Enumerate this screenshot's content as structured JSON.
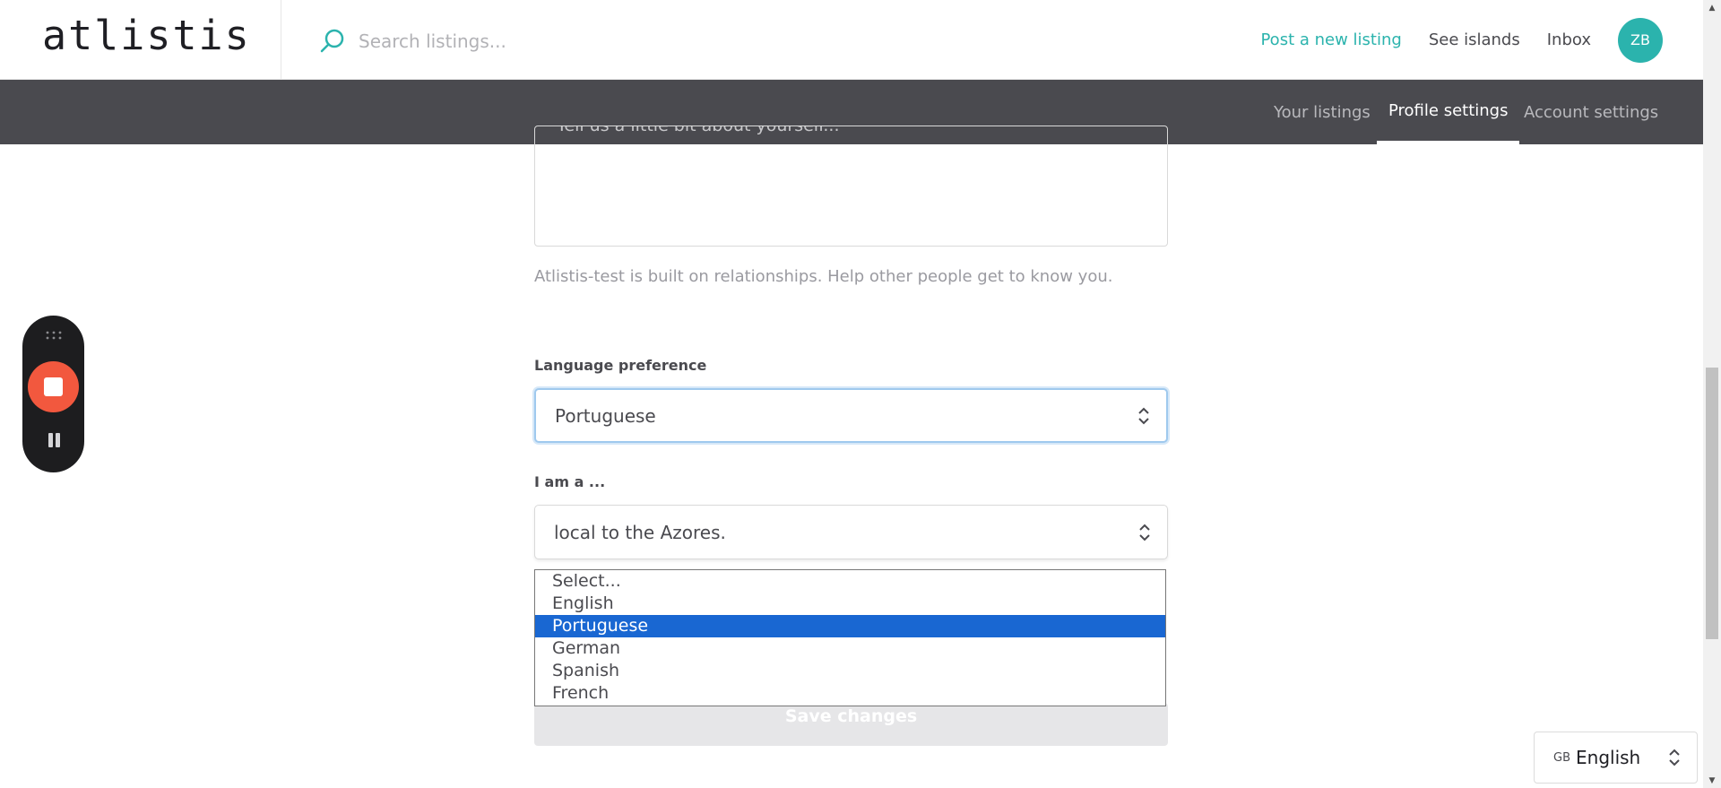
{
  "header": {
    "logo": "atlistis",
    "search_placeholder": "Search listings...",
    "post_listing": "Post a new listing",
    "see_islands": "See islands",
    "inbox": "Inbox",
    "avatar_initials": "ZB"
  },
  "subnav": {
    "your_listings": "Your listings",
    "profile_settings": "Profile settings",
    "account_settings": "Account settings"
  },
  "form": {
    "bio_placeholder": "Tell us a little bit about yourself...",
    "bio_help": "Atlistis-test is built on relationships. Help other people get to know you.",
    "language_label": "Language preference",
    "language_value": "Portuguese",
    "iama_label": "I am a ...",
    "iama_value": "local to the Azores.",
    "language_options": [
      "Select...",
      "English",
      "Portuguese",
      "German",
      "Spanish",
      "French"
    ],
    "language_selected_index": 2,
    "save_button": "Save changes"
  },
  "footer_language": {
    "flag_code": "GB",
    "language": "English"
  },
  "colors": {
    "accent": "#2bb3ad",
    "subnav_bg": "#4a4a4f",
    "option_highlight": "#1967d2",
    "recorder_stop": "#f2583e"
  },
  "icons": {
    "search": "search-icon",
    "select_chevrons": "chevron-up-down-icon",
    "recorder_grip": "drag-grip-icon",
    "recorder_stop": "stop-icon",
    "recorder_pause": "pause-icon"
  }
}
